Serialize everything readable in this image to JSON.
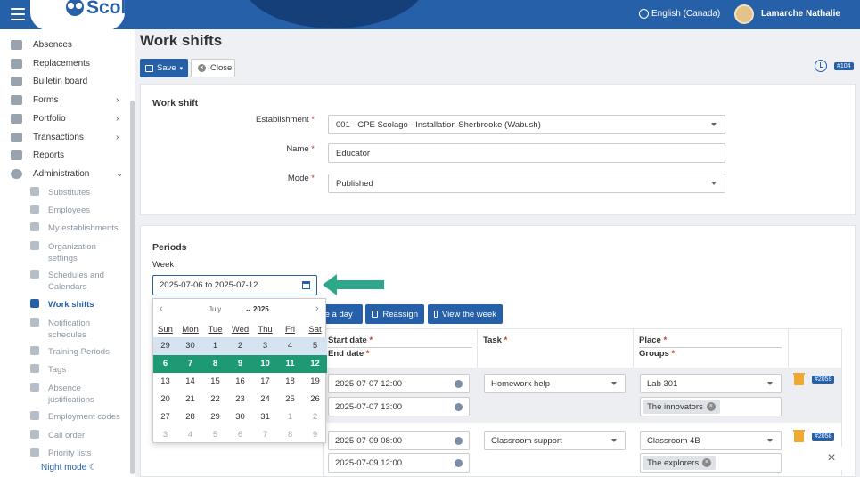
{
  "header": {
    "logo": "Scolago",
    "language": "English (Canada)",
    "user": "Lamarche Nathalie"
  },
  "sidebar": {
    "items": [
      {
        "label": "Absences"
      },
      {
        "label": "Replacements"
      },
      {
        "label": "Bulletin board"
      },
      {
        "label": "Forms",
        "chevron": "›"
      },
      {
        "label": "Portfolio",
        "chevron": "›"
      },
      {
        "label": "Transactions",
        "chevron": "›"
      },
      {
        "label": "Reports"
      },
      {
        "label": "Administration",
        "chevron": "⌄"
      }
    ],
    "subitems": [
      {
        "label": "Substitutes"
      },
      {
        "label": "Employees"
      },
      {
        "label": "My establishments"
      },
      {
        "label": "Organization settings"
      },
      {
        "label": "Schedules and Calendars"
      },
      {
        "label": "Work shifts"
      },
      {
        "label": "Notification schedules"
      },
      {
        "label": "Training Periods"
      },
      {
        "label": "Tags"
      },
      {
        "label": "Absence justifications"
      },
      {
        "label": "Employment codes"
      },
      {
        "label": "Call order"
      },
      {
        "label": "Priority lists"
      }
    ],
    "night_mode": "Night mode ☾"
  },
  "page": {
    "title": "Work shifts",
    "save_label": "Save",
    "close_label": "Close",
    "record_badge": "#104"
  },
  "work_shift": {
    "section_title": "Work shift",
    "establishment_label": "Establishment",
    "establishment_value": "001 - CPE Scolago - Installation Sherbrooke (Wabush)",
    "name_label": "Name",
    "name_value": "Educator",
    "mode_label": "Mode",
    "mode_value": "Published",
    "required_mark": "*"
  },
  "periods": {
    "section_title": "Periods",
    "week_label": "Week",
    "week_value": "2025-07-06 to 2025-07-12",
    "buttons": {
      "day": "te a day",
      "reassign": "Reassign",
      "view_week": "View the week"
    },
    "columns": {
      "start": "Start date",
      "end": "End date",
      "task": "Task",
      "place": "Place",
      "groups": "Groups"
    },
    "rows": [
      {
        "start": "2025-07-07 12:00",
        "end": "2025-07-07 13:00",
        "task": "Homework help",
        "place": "Lab 301",
        "group": "The innovators",
        "badge": "#2059"
      },
      {
        "start": "2025-07-09 08:00",
        "end": "2025-07-09 12:00",
        "task": "Classroom support",
        "place": "Classroom 4B",
        "group": "The explorers",
        "badge": "#2058"
      }
    ]
  },
  "calendar": {
    "prev": "‹",
    "next": "›",
    "month": "July",
    "year_chevron": "⌄",
    "year": "2025",
    "days_of_week": [
      "Sun",
      "Mon",
      "Tue",
      "Wed",
      "Thu",
      "Fri",
      "Sat"
    ],
    "weeks": [
      [
        "29",
        "30",
        "1",
        "2",
        "3",
        "4",
        "5"
      ],
      [
        "6",
        "7",
        "8",
        "9",
        "10",
        "11",
        "12"
      ],
      [
        "13",
        "14",
        "15",
        "16",
        "17",
        "18",
        "19"
      ],
      [
        "20",
        "21",
        "22",
        "23",
        "24",
        "25",
        "26"
      ],
      [
        "27",
        "28",
        "29",
        "30",
        "31",
        "1",
        "2"
      ],
      [
        "3",
        "4",
        "5",
        "6",
        "7",
        "8",
        "9"
      ]
    ],
    "selected_week_index": 1
  },
  "colors": {
    "primary": "#2660a8",
    "selected_week": "#1d9a73",
    "arrow": "#2ea88a",
    "trash": "#f0a930"
  }
}
